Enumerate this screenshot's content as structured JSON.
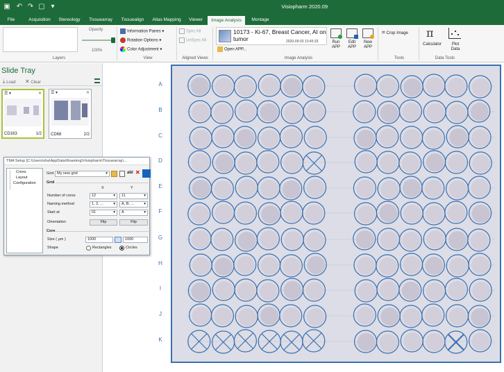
{
  "app": {
    "title": "Visiopharm 2020.09"
  },
  "menu": {
    "tabs": [
      "File",
      "Acquisition",
      "Stereology",
      "Tissuearray",
      "Tissuealign",
      "Atlas Mapping",
      "Viewer",
      "Image Analysis",
      "Montage"
    ],
    "active": "Image Analysis"
  },
  "ribbon": {
    "opacity_label": "Opacity",
    "opacity_value": "100%",
    "layers_label": "Layers",
    "info_panes": "Information Panes",
    "rotation_options": "Rotation Options",
    "color_adjustment": "Color Adjustment",
    "view_label": "View",
    "sync_all": "Sync All",
    "unsync_all": "UnSync All",
    "aligned_views_label": "Aligned Views",
    "app_name": "10173 - Ki-67, Breast Cancer, AI on tumor",
    "app_date": "2020-09-03 13:45:33",
    "open_app": "Open APP...",
    "run_app": "Run APP",
    "edit_app": "Edit APP",
    "new_app": "New APP",
    "image_analysis_label": "Image Analysis",
    "crop_image": "Crop Image",
    "tools_label": "Tools",
    "calculator": "Calculator",
    "plot_data": "Plot Data",
    "data_tools_label": "Data Tools"
  },
  "tray": {
    "title": "Slide Tray",
    "load": "Load",
    "clear": "Clear",
    "slides": [
      {
        "name": "CD163",
        "index": "1/2"
      },
      {
        "name": "CD68",
        "index": "2/2"
      }
    ]
  },
  "dialog": {
    "title": "TMA Setup [C:\\Users\\sha\\AppData\\Roaming\\Visiopharm\\Tissuearray\\...",
    "tree": [
      "Cores",
      "Layout",
      "Configuration"
    ],
    "grid_label": "Grid",
    "grid_value": "My new grid",
    "grid_section": "Grid",
    "col_x": "X",
    "col_y": "Y",
    "num_cores_label": "Number of cores",
    "num_cores_x": "12",
    "num_cores_y": "11",
    "naming_label": "Naming method",
    "naming_x": "1, 2, ...",
    "naming_y": "A, B, ...",
    "start_label": "Start at",
    "start_x": "01",
    "start_y": "A",
    "orientation_label": "Orientation",
    "flip": "Flip",
    "core_section": "Core",
    "size_label": "Size ( μm )",
    "size_x": "1000",
    "size_y": "1000",
    "shape_label": "Shape",
    "shape_rect": "Rectangles",
    "shape_circle": "Circles",
    "shape_selected": "Circles"
  },
  "viewer": {
    "row_labels": [
      "A",
      "B",
      "C",
      "D",
      "E",
      "F",
      "G",
      "H",
      "I",
      "J",
      "K"
    ],
    "crossed_cores": [
      "D06",
      "K01",
      "K02",
      "K03",
      "K04",
      "K05",
      "K06",
      "K11"
    ]
  },
  "colors": {
    "brand": "#1e6b3a",
    "grid": "#3a6fb0",
    "slide": "#dcdde6"
  }
}
